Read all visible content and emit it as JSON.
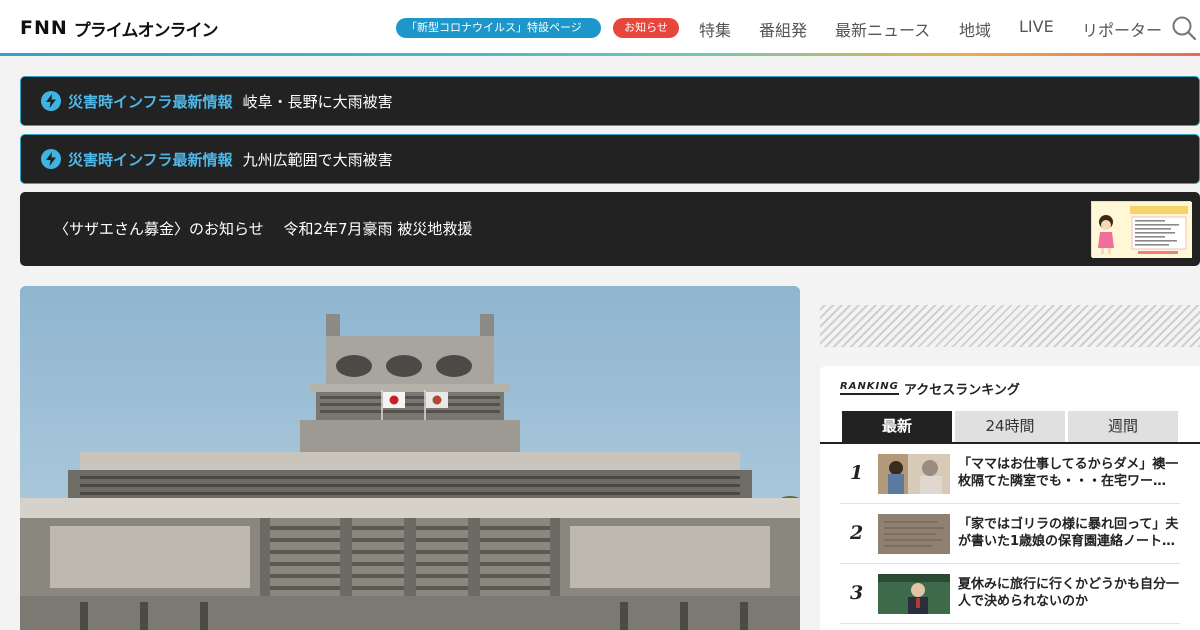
{
  "header": {
    "logo_fnn": "FNN",
    "logo_rest": "プライムオンライン",
    "corona_pill": "「新型コロナウイルス」特設ページ",
    "news_pill": "お知らせ",
    "nav": [
      "特集",
      "番組発",
      "最新ニュース",
      "地域",
      "LIVE",
      "リポーター"
    ],
    "colors": {
      "corona": "#1d97c9",
      "notice": "#e8463a"
    }
  },
  "alerts": [
    {
      "label": "災害時インフラ最新情報",
      "text": "岐阜・長野に大雨被害"
    },
    {
      "label": "災害時インフラ最新情報",
      "text": "九州広範囲で大雨被害"
    }
  ],
  "sazae_banner": {
    "text": "〈サザエさん募金〉のお知らせ　 令和2年7月豪雨 被災地救援"
  },
  "ranking": {
    "label_en": "RANKING",
    "label_ja": "アクセスランキング",
    "tabs": [
      "最新",
      "24時間",
      "週間"
    ],
    "active_tab": "最新",
    "items": [
      {
        "rank": "1",
        "title": "「ママはお仕事してるからダメ」襖一枚隔てた隣室でも・・・在宅ワー…"
      },
      {
        "rank": "2",
        "title": "「家ではゴリラの様に暴れ回って」夫が書いた1歳娘の保育園連絡ノート…"
      },
      {
        "rank": "3",
        "title": "夏休みに旅行に行くかどうかも自分一人で決められないのか"
      }
    ]
  }
}
